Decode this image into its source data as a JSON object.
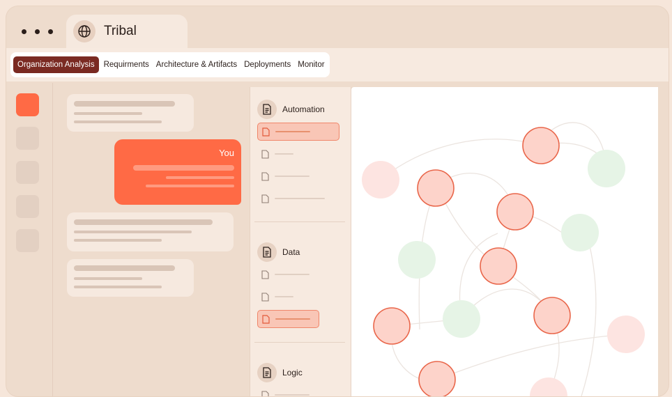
{
  "app": {
    "title": "Tribal"
  },
  "nav": {
    "tabs": [
      {
        "label": "Organization Analysis",
        "active": true
      },
      {
        "label": "Requirments"
      },
      {
        "label": "Architecture & Artifacts"
      },
      {
        "label": "Deployments"
      },
      {
        "label": "Monitor"
      }
    ]
  },
  "chat": {
    "user_label": "You"
  },
  "files": {
    "sections": [
      {
        "title": "Automation"
      },
      {
        "title": "Data"
      },
      {
        "title": "Logic"
      }
    ]
  },
  "icons": {
    "app": "globe-icon",
    "section": "document-icon",
    "file": "file-icon",
    "window": "window-dots-icon"
  },
  "colors": {
    "accent": "#FF6A45",
    "nav_active": "#7A2A22",
    "node_active": "#FDD3CA",
    "node_active_stroke": "#E9664A",
    "node_pink": "#FDE4E1",
    "node_green": "#E6F4E6"
  }
}
